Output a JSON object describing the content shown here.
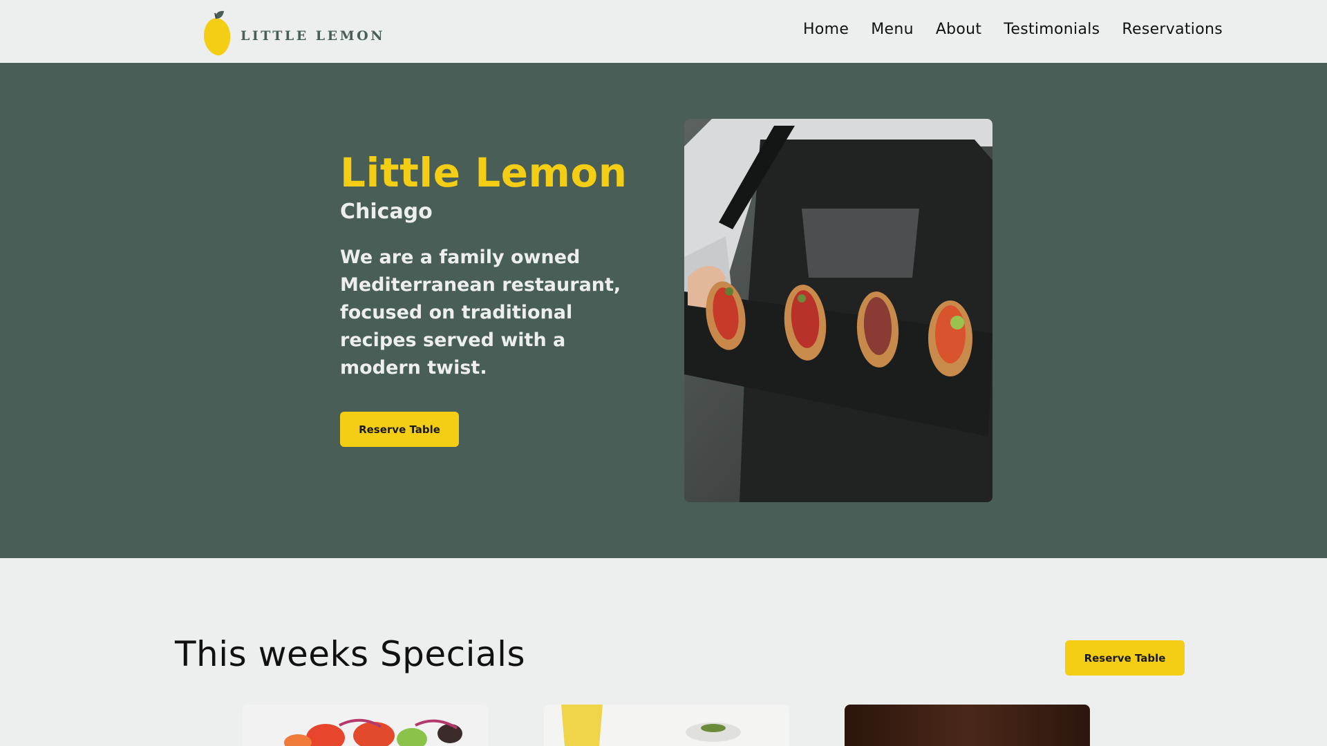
{
  "brand": {
    "logo_text": "LITTLE LEMON",
    "primary_color": "#495e57",
    "accent_color": "#f4ce14",
    "background_color": "#edefee"
  },
  "nav": {
    "items": [
      {
        "label": "Home"
      },
      {
        "label": "Menu"
      },
      {
        "label": "About"
      },
      {
        "label": "Testimonials"
      },
      {
        "label": "Reservations"
      }
    ]
  },
  "hero": {
    "title": "Little Lemon",
    "subtitle": "Chicago",
    "description": "We are a family owned Mediterranean restaurant, focused on traditional recipes served with a modern twist.",
    "button_label": "Reserve Table"
  },
  "specials": {
    "title": "This weeks Specials",
    "button_label": "Reserve Table"
  },
  "icons": {
    "logo": "lemon-icon"
  }
}
